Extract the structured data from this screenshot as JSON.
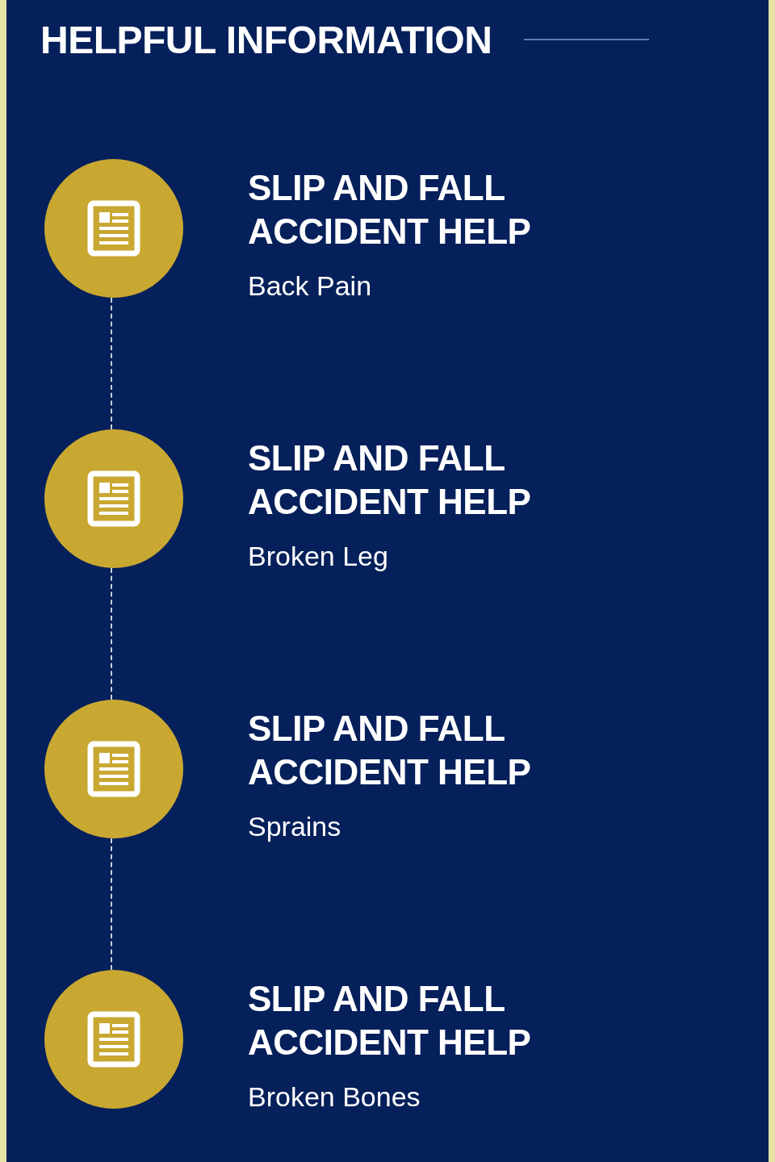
{
  "heading": "HELPFUL INFORMATION",
  "items": [
    {
      "title": "SLIP AND FALL ACCIDENT HELP",
      "subtitle": "Back Pain"
    },
    {
      "title": "SLIP AND FALL ACCIDENT HELP",
      "subtitle": "Broken Leg"
    },
    {
      "title": "SLIP AND FALL ACCIDENT HELP",
      "subtitle": "Sprains"
    },
    {
      "title": "SLIP AND FALL ACCIDENT HELP",
      "subtitle": "Broken Bones"
    }
  ]
}
